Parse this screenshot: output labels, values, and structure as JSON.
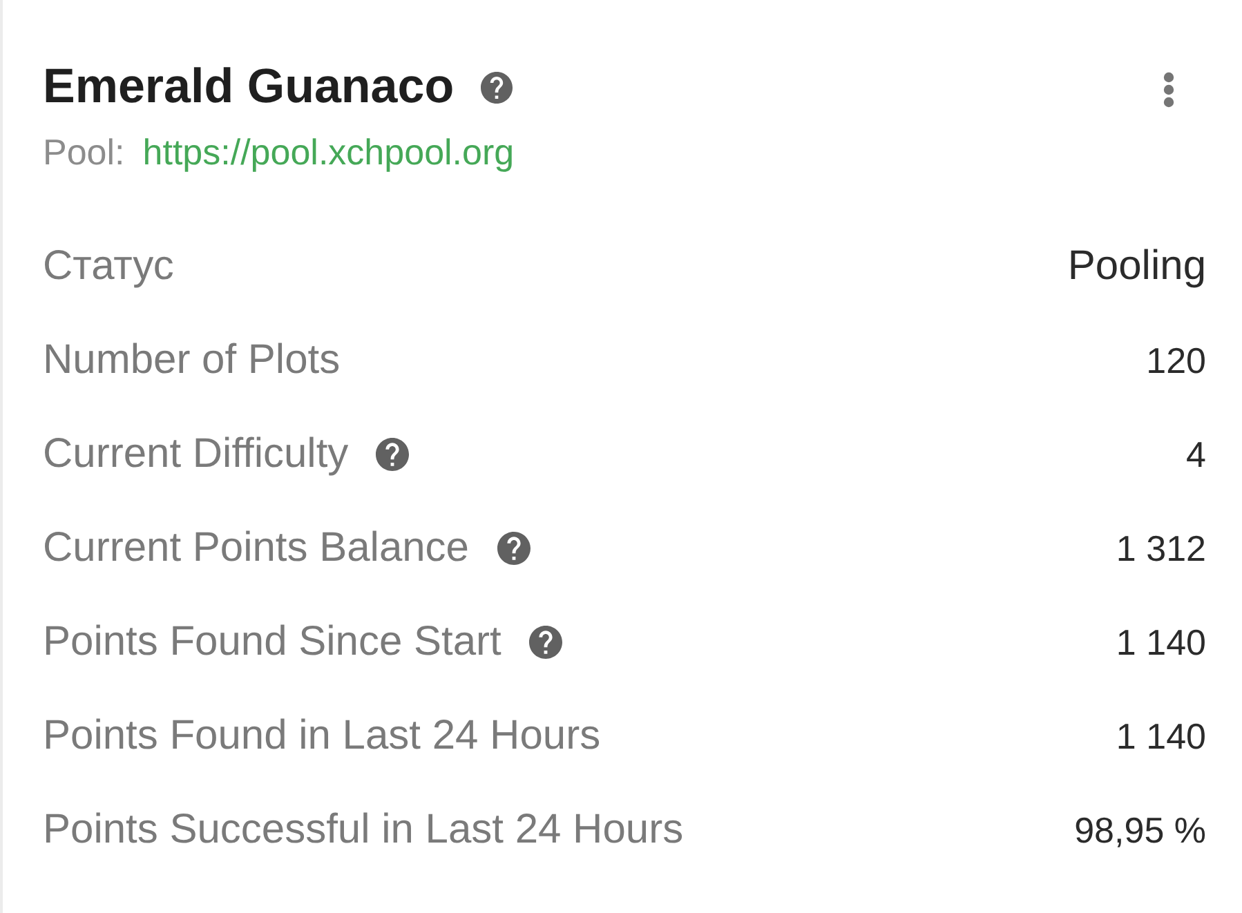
{
  "card": {
    "title": "Emerald Guanaco",
    "title_help": true,
    "pool_label": "Pool:",
    "pool_url": "https://pool.xchpool.org"
  },
  "rows": [
    {
      "label": "Статус",
      "value": "Pooling",
      "help": false,
      "kind": "status"
    },
    {
      "label": "Number of Plots",
      "value": "120",
      "help": false,
      "kind": "number"
    },
    {
      "label": "Current Difficulty",
      "value": "4",
      "help": true,
      "kind": "number"
    },
    {
      "label": "Current Points Balance",
      "value": "1 312",
      "help": true,
      "kind": "number"
    },
    {
      "label": "Points Found Since Start",
      "value": "1 140",
      "help": true,
      "kind": "number"
    },
    {
      "label": "Points Found in Last 24 Hours",
      "value": "1 140",
      "help": false,
      "kind": "number"
    },
    {
      "label": "Points Successful in Last 24 Hours",
      "value": "98,95 %",
      "help": false,
      "kind": "number"
    }
  ]
}
